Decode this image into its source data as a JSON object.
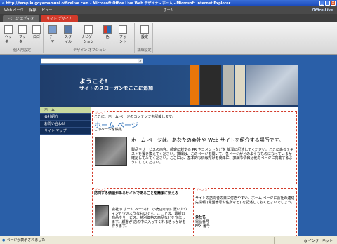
{
  "window": {
    "title": "http://temp.kugoyamamuni.officelive.com - Microsoft Office Live Web デザイナ - ホーム - Microsoft Internet Explorer",
    "min": "_",
    "max": "□",
    "close": "×"
  },
  "toolbar": {
    "web_page": "Web ページ",
    "save": "保存",
    "view": "ビュー",
    "center_title": "ホーム",
    "brand": "Office Live"
  },
  "tabs": [
    {
      "label": "ページ エディタ"
    },
    {
      "label": "サイト デザイナ"
    }
  ],
  "ribbon": {
    "groups": [
      {
        "label": "個人用設定",
        "buttons": [
          "ヘッダー",
          "フッター",
          "ロゴ"
        ]
      },
      {
        "label": "デザイン オプション",
        "buttons": [
          "テーマ",
          "スタイル",
          "ナビゲーション",
          "色",
          "フォント"
        ]
      },
      {
        "label": "詳細設定",
        "buttons": [
          "設定"
        ]
      }
    ]
  },
  "banner": {
    "welcome": "ようこそ!",
    "slogan": "サイトのスローガンをここに追加"
  },
  "nav": {
    "items": [
      {
        "label": "ホーム"
      },
      {
        "label": "会社紹介"
      },
      {
        "label": "お問い合わせ"
      },
      {
        "label": "サイト マップ"
      }
    ]
  },
  "content": {
    "zone_label": "ゾーン 1",
    "intro": "ここに、ホーム ページのコンテンツを記載します。",
    "page_title": "ホーム ページ",
    "edit_link": "このページを編集",
    "headline": "ホーム ページは、あなたの会社や Web サイトを紹介する場所です。",
    "body": "製品やサービスの内容、顧客に対する PR やコメントなどを 簡潔に記述してください。ここにあるテキストを置き換えてください。詳細は、このページを開いて、各ページがどのようなものになっているか確認してみてください。ここには、基本的な情報だけを簡単に、詳細な情報は他のページに掲載するようにしてください。",
    "zone2_label": "ゾーン 2",
    "zone2_title": "訪問する価値があるサイトであることを簡潔に伝える",
    "zone2_body": "会社の ホーム ページは、小売店の表に置いたウィンドウのようなものです。ここでは、最新の商品やサービス、特別価格の商品などを宣伝します。顧客が 店の中に入ってくれるきっかけを作ります。",
    "zone3_label": "ゾーン 3",
    "zone3_body": "サイトの訪問者の目に付きやすい、ホーム ページに会社の連絡先情報 (電話番号や住所など) を記述しておくとよいでしょう。",
    "company_name": "会社名",
    "phone": "電話番号",
    "fax": "FAX 番号"
  },
  "status": {
    "text": "ページが表示されました",
    "zone": "インターネット"
  },
  "colors": {
    "banner": "#1f3d6b",
    "orange_stripe": "#e8760a",
    "nav": "#122e5a",
    "zone_border": "#d23a2a",
    "title_blue": "#2a6eb8"
  }
}
